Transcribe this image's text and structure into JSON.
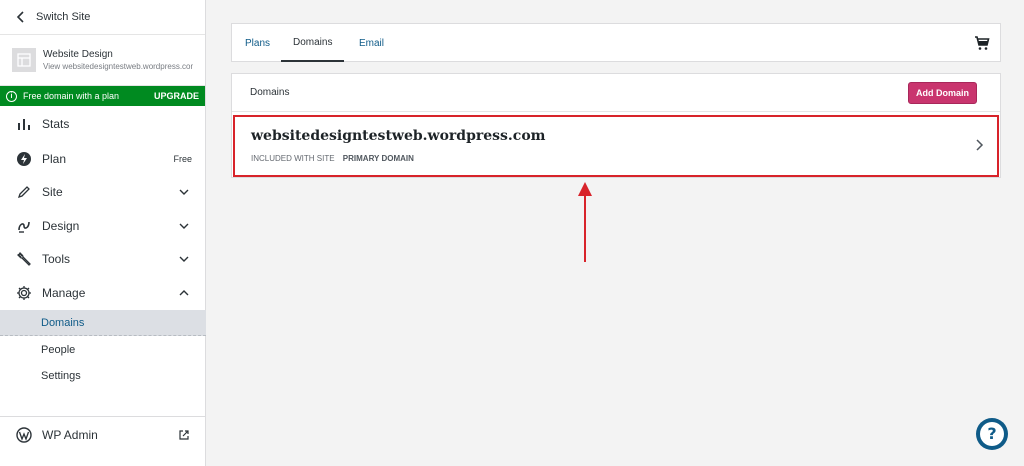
{
  "sidebar": {
    "switch_site": "Switch Site",
    "site": {
      "name": "Website Design",
      "url": "View websitedesigntestweb.wordpress.com"
    },
    "promo": {
      "text": "Free domain with a plan",
      "cta": "UPGRADE",
      "color": "#008a20"
    },
    "menu": {
      "stats": "Stats",
      "plan": "Plan",
      "plan_badge": "Free",
      "site": "Site",
      "design": "Design",
      "tools": "Tools",
      "manage": "Manage"
    },
    "manage_sub": {
      "domains": "Domains",
      "people": "People",
      "settings": "Settings"
    },
    "wp_admin": "WP Admin"
  },
  "tabs": {
    "plans": "Plans",
    "domains": "Domains",
    "email": "Email",
    "selected": "Domains"
  },
  "domains_card": {
    "title": "Domains",
    "add_button": "Add Domain",
    "add_button_color": "#c9356e",
    "domain": {
      "name": "websitedesigntestweb.wordpress.com",
      "tag1": "INCLUDED WITH SITE",
      "tag2": "PRIMARY DOMAIN"
    }
  },
  "help": {
    "label": "?"
  },
  "annotation_color": "#d8232a"
}
